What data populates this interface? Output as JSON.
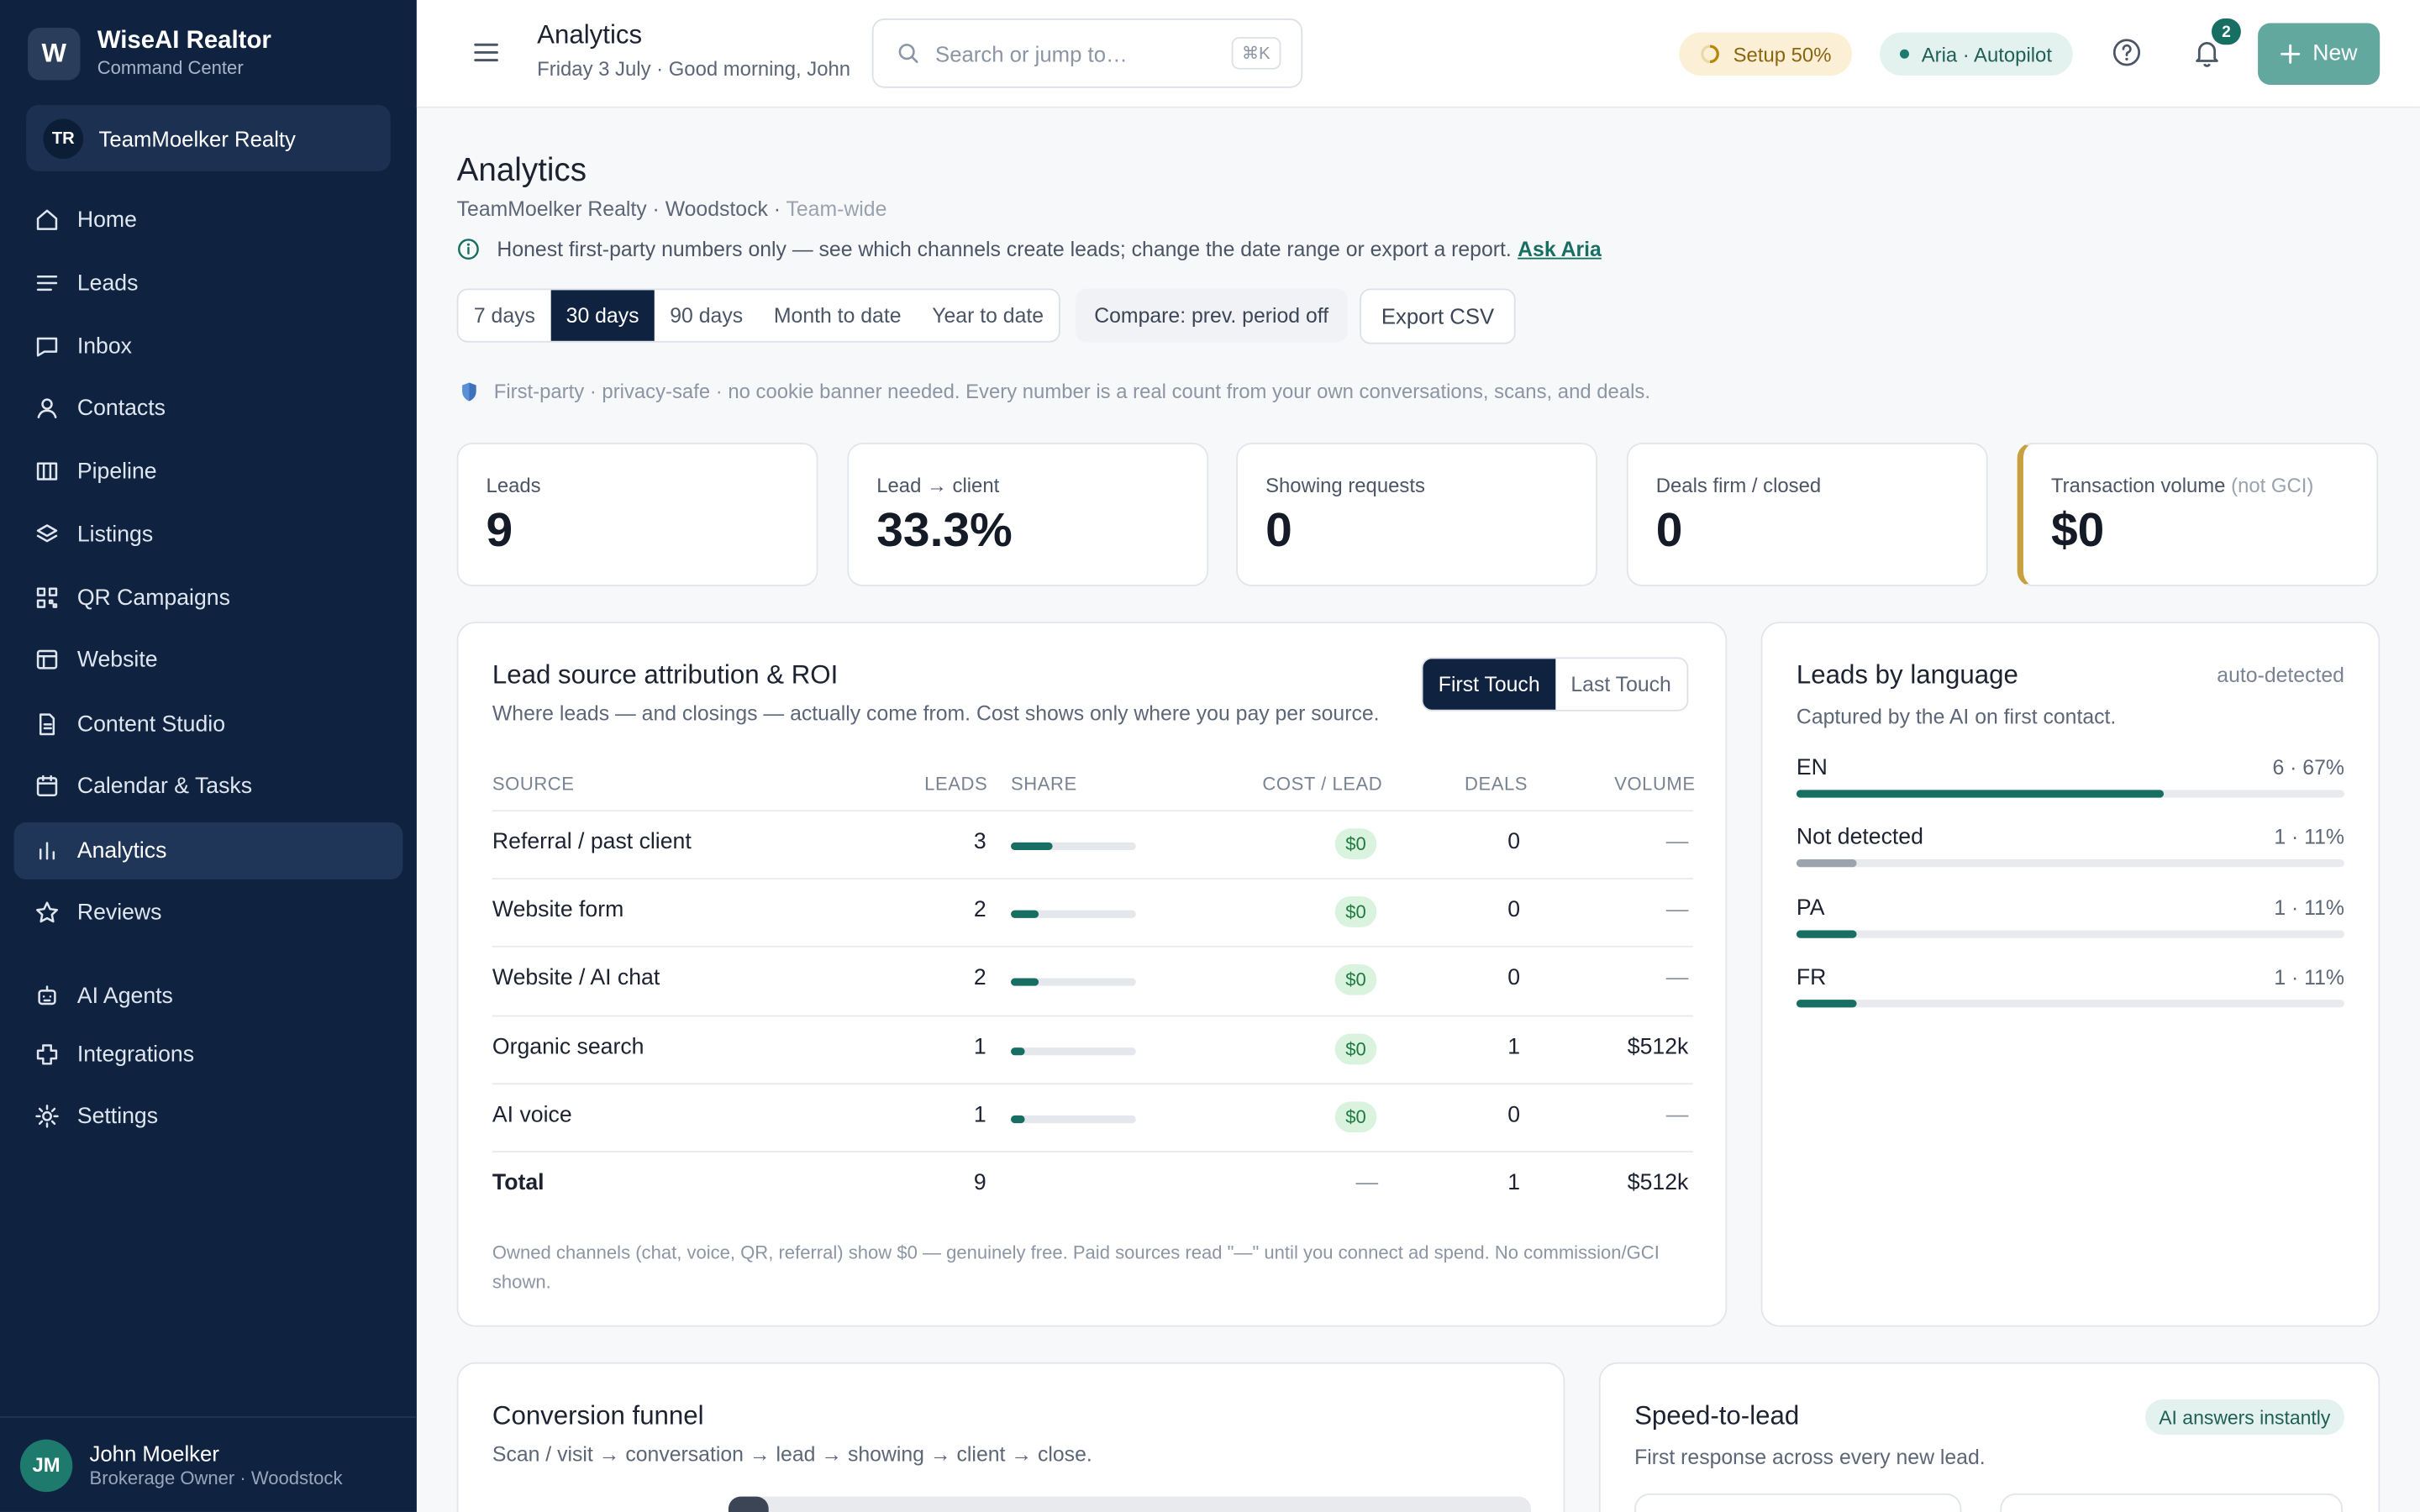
{
  "brand": {
    "logo": "W",
    "name": "WiseAI Realtor",
    "subtitle": "Command Center"
  },
  "team": {
    "initials": "TR",
    "name": "TeamMoelker Realty"
  },
  "nav": [
    {
      "label": "Home",
      "icon": "home-icon"
    },
    {
      "label": "Leads",
      "icon": "list-icon"
    },
    {
      "label": "Inbox",
      "icon": "inbox-icon"
    },
    {
      "label": "Contacts",
      "icon": "user-icon"
    },
    {
      "label": "Pipeline",
      "icon": "columns-icon"
    },
    {
      "label": "Listings",
      "icon": "layers-icon"
    },
    {
      "label": "QR Campaigns",
      "icon": "qr-icon"
    },
    {
      "label": "Website",
      "icon": "window-icon"
    },
    {
      "label": "Content Studio",
      "icon": "document-icon"
    },
    {
      "label": "Calendar & Tasks",
      "icon": "calendar-icon"
    },
    {
      "label": "Analytics",
      "icon": "bar-chart-icon",
      "active": true
    },
    {
      "label": "Reviews",
      "icon": "star-icon"
    },
    {
      "label": "AI Agents",
      "icon": "robot-icon"
    },
    {
      "label": "Integrations",
      "icon": "puzzle-icon"
    },
    {
      "label": "Settings",
      "icon": "gear-icon"
    }
  ],
  "user": {
    "initials": "JM",
    "name": "John Moelker",
    "role": "Brokerage Owner · Woodstock"
  },
  "topbar": {
    "title": "Analytics",
    "subtitle": "Friday 3 July · Good morning, John",
    "search_placeholder": "Search or jump to…",
    "search_shortcut": "⌘K",
    "setup": "Setup 50%",
    "aria": "Aria · Autopilot",
    "notifications": "2",
    "new_label": "New"
  },
  "page": {
    "title": "Analytics",
    "subtitle": "TeamMoelker Realty · Woodstock · ",
    "subtitle_scope": "Team-wide",
    "info": "Honest first-party numbers only — see which channels create leads; change the date range or export a report.",
    "info_link": "Ask Aria",
    "ranges": [
      "7 days",
      "30 days",
      "90 days",
      "Month to date",
      "Year to date"
    ],
    "active_range": 1,
    "compare": "Compare: prev. period off",
    "export": "Export CSV",
    "privacy": "First-party · privacy-safe · no cookie banner needed. Every number is a real count from your own conversations, scans, and deals."
  },
  "kpis": [
    {
      "label": "Leads",
      "value": "9"
    },
    {
      "label": "Lead → client",
      "value": "33.3%"
    },
    {
      "label": "Showing requests",
      "value": "0"
    },
    {
      "label": "Deals firm / closed",
      "value": "0"
    },
    {
      "label": "Transaction volume",
      "label_note": "(not GCI)",
      "value": "$0"
    }
  ],
  "attribution": {
    "title": "Lead source attribution & ROI",
    "subtitle": "Where leads — and closings — actually come from. Cost shows only where you pay per source.",
    "toggle": [
      "First Touch",
      "Last Touch"
    ],
    "headers": {
      "source": "SOURCE",
      "leads": "LEADS",
      "share": "SHARE",
      "cost": "COST / LEAD",
      "deals": "DEALS",
      "volume": "VOLUME"
    },
    "rows": [
      {
        "source": "Referral / past client",
        "leads": "3",
        "share": 0.333,
        "cost": "$0",
        "deals": "0",
        "volume": "—"
      },
      {
        "source": "Website form",
        "leads": "2",
        "share": 0.222,
        "cost": "$0",
        "deals": "0",
        "volume": "—"
      },
      {
        "source": "Website / AI chat",
        "leads": "2",
        "share": 0.222,
        "cost": "$0",
        "deals": "0",
        "volume": "—"
      },
      {
        "source": "Organic search",
        "leads": "1",
        "share": 0.111,
        "cost": "$0",
        "deals": "1",
        "volume": "$512k"
      },
      {
        "source": "AI voice",
        "leads": "1",
        "share": 0.111,
        "cost": "$0",
        "deals": "0",
        "volume": "—"
      }
    ],
    "total": {
      "label": "Total",
      "leads": "9",
      "cost": "—",
      "deals": "1",
      "volume": "$512k"
    },
    "note": "Owned channels (chat, voice, QR, referral) show $0 — genuinely free. Paid sources read \"—\" until you connect ad spend. No commission/GCI shown."
  },
  "languages": {
    "title": "Leads by language",
    "tag": "auto-detected",
    "subtitle": "Captured by the AI on first contact.",
    "items": [
      {
        "name": "EN",
        "value": "6 · 67%",
        "share": 0.67,
        "color": "#176e62"
      },
      {
        "name": "Not detected",
        "value": "1 · 11%",
        "share": 0.11,
        "color": "#9ba3ae"
      },
      {
        "name": "PA",
        "value": "1 · 11%",
        "share": 0.11,
        "color": "#176e62"
      },
      {
        "name": "FR",
        "value": "1 · 11%",
        "share": 0.11,
        "color": "#176e62"
      }
    ]
  },
  "funnel": {
    "title": "Conversion funnel",
    "subtitle": "Scan / visit → conversation → lead → showing → client → close."
  },
  "speed": {
    "title": "Speed-to-lead",
    "subtitle": "First response across every new lead.",
    "chip": "AI answers instantly"
  }
}
